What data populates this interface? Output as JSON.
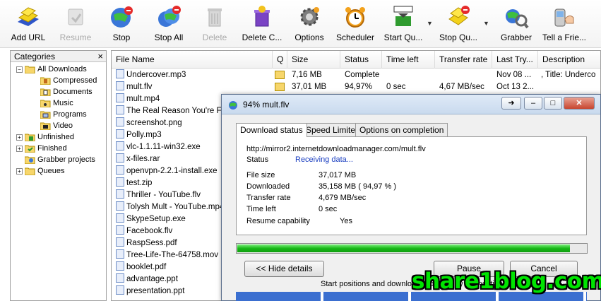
{
  "toolbar": {
    "buttons": [
      {
        "label": "Add URL",
        "icon": "add-url-icon"
      },
      {
        "label": "Resume",
        "icon": "resume-icon"
      },
      {
        "label": "Stop",
        "icon": "stop-icon"
      },
      {
        "label": "Stop All",
        "icon": "stop-all-icon"
      },
      {
        "label": "Delete",
        "icon": "delete-icon"
      },
      {
        "label": "Delete C...",
        "icon": "delete-completed-icon"
      },
      {
        "label": "Options",
        "icon": "options-gear-icon"
      },
      {
        "label": "Scheduler",
        "icon": "alarm-clock-icon"
      },
      {
        "label": "Start Qu...",
        "icon": "start-queue-icon"
      },
      {
        "label": "Stop Qu...",
        "icon": "stop-queue-icon"
      },
      {
        "label": "Grabber",
        "icon": "grabber-icon"
      },
      {
        "label": "Tell a Frie...",
        "icon": "tell-a-friend-icon"
      }
    ]
  },
  "sidebar": {
    "title": "Categories",
    "close": "×",
    "items": [
      {
        "label": "All Downloads"
      },
      {
        "label": "Compressed"
      },
      {
        "label": "Documents"
      },
      {
        "label": "Music"
      },
      {
        "label": "Programs"
      },
      {
        "label": "Video"
      },
      {
        "label": "Unfinished"
      },
      {
        "label": "Finished"
      },
      {
        "label": "Grabber projects"
      },
      {
        "label": "Queues"
      }
    ]
  },
  "list": {
    "columns": [
      "File Name",
      "Q",
      "Size",
      "Status",
      "Time left",
      "Transfer rate",
      "Last Try...",
      "Description"
    ],
    "rows": [
      {
        "name": "Undercover.mp3",
        "size": "7,16  MB",
        "status": "Complete",
        "time_left": "",
        "rate": "",
        "last_try": "Nov 08 ...",
        "desc": ", Title: Underco"
      },
      {
        "name": "mult.flv",
        "size": "37,01  MB",
        "status": "94,97%",
        "time_left": "0 sec",
        "rate": "4,67  MB/sec",
        "last_try": "Oct 13 2...",
        "desc": ""
      },
      {
        "name": "mult.mp4"
      },
      {
        "name": "The Real Reason You're Flab"
      },
      {
        "name": "screenshot.png"
      },
      {
        "name": "Polly.mp3"
      },
      {
        "name": "vlc-1.1.11-win32.exe"
      },
      {
        "name": "x-files.rar"
      },
      {
        "name": "openvpn-2.2.1-install.exe"
      },
      {
        "name": "test.zip"
      },
      {
        "name": "Thriller - YouTube.flv"
      },
      {
        "name": "Tolysh Mult - YouTube.mp4"
      },
      {
        "name": "SkypeSetup.exe"
      },
      {
        "name": "Facebook.flv"
      },
      {
        "name": "RaspSess.pdf"
      },
      {
        "name": "Tree-Life-The-64758.mov"
      },
      {
        "name": "booklet.pdf"
      },
      {
        "name": "advantage.ppt"
      },
      {
        "name": "presentation.ppt"
      }
    ]
  },
  "dialog": {
    "title": "94% mult.flv",
    "tabs": [
      "Download status",
      "Speed Limiter",
      "Options on completion"
    ],
    "url": "http://mirror2.internetdownloadmanager.com/mult.flv",
    "status_label": "Status",
    "status_value": "Receiving data...",
    "file_size_label": "File size",
    "file_size_value": "37,017  MB",
    "downloaded_label": "Downloaded",
    "downloaded_value": "35,158  MB  ( 94,97 % )",
    "transfer_rate_label": "Transfer rate",
    "transfer_rate_value": "4,679  MB/sec",
    "time_left_label": "Time left",
    "time_left_value": "0 sec",
    "resume_label": "Resume capability",
    "resume_value": "Yes",
    "progress_percent": 94.97,
    "hide_details": "<< Hide details",
    "pause": "Pause",
    "cancel": "Cancel",
    "start_positions": "Start positions and download progress by connections"
  },
  "watermark": "share1blog.com",
  "colors": {
    "progress_green": "#18b818",
    "status_blue": "#1a3ec0",
    "watermark_green": "#00e400"
  }
}
